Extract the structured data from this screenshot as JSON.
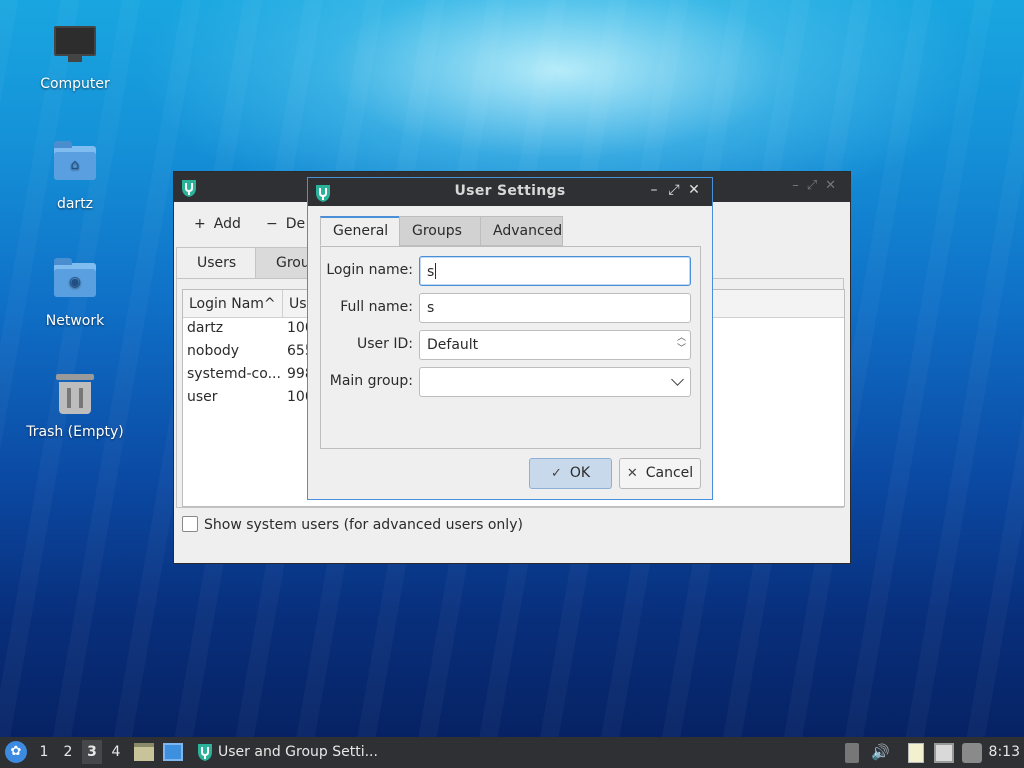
{
  "desktop": {
    "icons": [
      {
        "label": "Computer",
        "icon": "computer-icon"
      },
      {
        "label": "dartz",
        "icon": "home-folder-icon"
      },
      {
        "label": "Network",
        "icon": "network-folder-icon"
      },
      {
        "label": "Trash (Empty)",
        "icon": "trash-icon"
      }
    ]
  },
  "back_window": {
    "toolbar": {
      "add_label": "Add",
      "delete_label": "De"
    },
    "tabs": [
      "Users",
      "Group"
    ],
    "columns": [
      "Login Nam",
      "Use"
    ],
    "rows": [
      {
        "login": "dartz",
        "uid": "100"
      },
      {
        "login": "nobody",
        "uid": "655"
      },
      {
        "login": "systemd-co...",
        "uid": "998"
      },
      {
        "login": "user",
        "uid": "100"
      }
    ],
    "show_system_users_label": "Show system users (for advanced users only)",
    "show_system_users_checked": false
  },
  "dialog": {
    "title": "User Settings",
    "tabs": [
      "General",
      "Groups",
      "Advanced"
    ],
    "active_tab": "General",
    "fields": {
      "login_name_label": "Login name:",
      "login_name_value": "s",
      "full_name_label": "Full name:",
      "full_name_value": "s",
      "user_id_label": "User ID:",
      "user_id_value": "Default",
      "main_group_label": "Main group:",
      "main_group_value": ""
    },
    "ok_label": "OK",
    "cancel_label": "Cancel"
  },
  "taskbar": {
    "workspaces": [
      "1",
      "2",
      "3",
      "4"
    ],
    "active_workspace": "3",
    "task_label": "User and Group Setti...",
    "clock": "8:13"
  },
  "colors": {
    "accent": "#4a90d9",
    "titlebar": "#2f3033",
    "app_logo": "#2bb39a"
  }
}
